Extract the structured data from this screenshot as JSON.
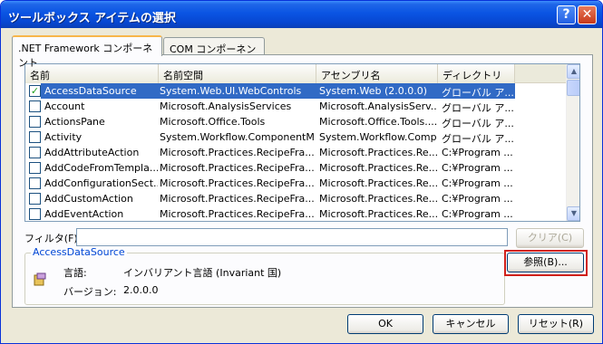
{
  "window": {
    "title": "ツールボックス アイテムの選択"
  },
  "titlebar": {
    "help_glyph": "?",
    "close_glyph": "✕"
  },
  "tabs": [
    {
      "label": ".NET Framework コンポーネント"
    },
    {
      "label": "COM コンポーネント"
    }
  ],
  "list": {
    "columns": [
      "名前",
      "名前空間",
      "アセンブリ名",
      "ディレクトリ"
    ],
    "rows": [
      {
        "checked": true,
        "name": "AccessDataSource",
        "namespace": "System.Web.UI.WebControls",
        "assembly": "System.Web (2.0.0.0)",
        "directory": "グローバル ア..."
      },
      {
        "checked": false,
        "name": "Account",
        "namespace": "Microsoft.AnalysisServices",
        "assembly": "Microsoft.AnalysisServ...",
        "directory": "グローバル ア..."
      },
      {
        "checked": false,
        "name": "ActionsPane",
        "namespace": "Microsoft.Office.Tools",
        "assembly": "Microsoft.Office.Tools....",
        "directory": "グローバル ア..."
      },
      {
        "checked": false,
        "name": "Activity",
        "namespace": "System.Workflow.ComponentM...",
        "assembly": "System.Workflow.Comp...",
        "directory": "グローバル ア..."
      },
      {
        "checked": false,
        "name": "AddAttributeAction",
        "namespace": "Microsoft.Practices.RecipeFra...",
        "assembly": "Microsoft.Practices.Re...",
        "directory": "C:¥Program ..."
      },
      {
        "checked": false,
        "name": "AddCodeFromTempla...",
        "namespace": "Microsoft.Practices.RecipeFra...",
        "assembly": "Microsoft.Practices.Re...",
        "directory": "C:¥Program ..."
      },
      {
        "checked": false,
        "name": "AddConfigurationSect...",
        "namespace": "Microsoft.Practices.RecipeFra...",
        "assembly": "Microsoft.Practices.Re...",
        "directory": "C:¥Program ..."
      },
      {
        "checked": false,
        "name": "AddCustomAction",
        "namespace": "Microsoft.Practices.RecipeFra...",
        "assembly": "Microsoft.Practices.Re...",
        "directory": "C:¥Program ..."
      },
      {
        "checked": false,
        "name": "AddEventAction",
        "namespace": "Microsoft.Practices.RecipeFra...",
        "assembly": "Microsoft.Practices.Re...",
        "directory": "C:¥Program ..."
      }
    ]
  },
  "filter": {
    "label": "フィルタ(F):",
    "value": "",
    "clear_label": "クリア(C)"
  },
  "details": {
    "group_title": "AccessDataSource",
    "language_label": "言語:",
    "language_value": "インバリアント言語 (Invariant 国)",
    "version_label": "バージョン:",
    "version_value": "2.0.0.0"
  },
  "browse_label": "参照(B)...",
  "buttons": {
    "ok": "OK",
    "cancel": "キャンセル",
    "reset": "リセット(R)"
  },
  "colors": {
    "selection": "#316ac5",
    "highlight_box": "#d0201a",
    "titlebar": "#0a54e3"
  }
}
